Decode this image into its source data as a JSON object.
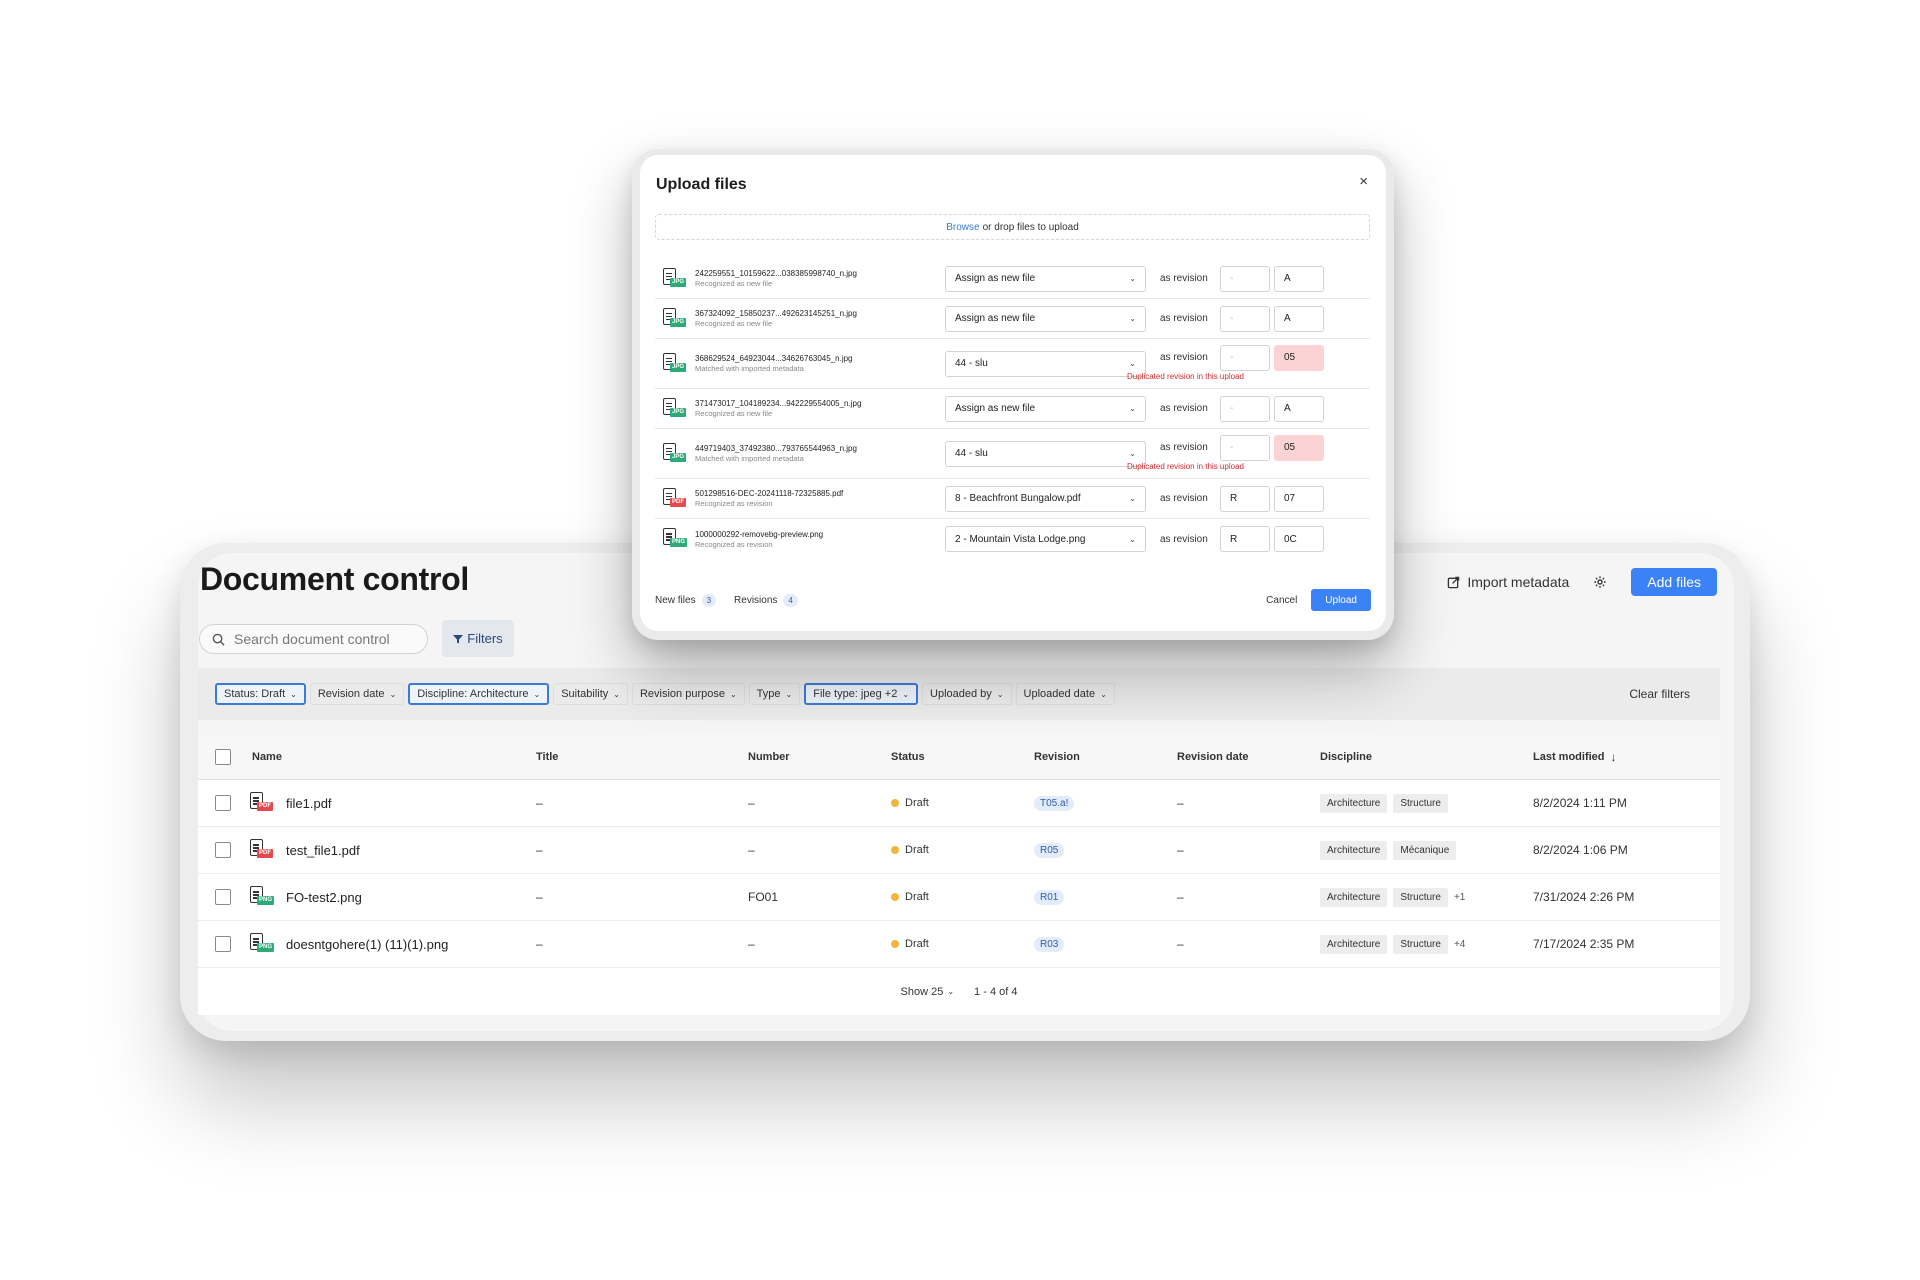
{
  "document_control": {
    "title": "Document control",
    "import_metadata_label": "Import metadata",
    "add_files_label": "Add files",
    "search_placeholder": "Search document control",
    "filters_label": "Filters",
    "filter_chips": [
      {
        "label": "Status: Draft",
        "active": true
      },
      {
        "label": "Revision date",
        "active": false
      },
      {
        "label": "Discipline: Architecture",
        "active": true
      },
      {
        "label": "Suitability",
        "active": false
      },
      {
        "label": "Revision purpose",
        "active": false
      },
      {
        "label": "Type",
        "active": false
      },
      {
        "label": "File type: jpeg +2",
        "active": true
      },
      {
        "label": "Uploaded by",
        "active": false
      },
      {
        "label": "Uploaded date",
        "active": false
      }
    ],
    "clear_filters_label": "Clear filters",
    "columns": {
      "name": "Name",
      "title": "Title",
      "number": "Number",
      "status": "Status",
      "revision": "Revision",
      "revision_date": "Revision date",
      "discipline": "Discipline",
      "last_modified": "Last modified"
    },
    "rows": [
      {
        "name": "file1.pdf",
        "type": "PDF",
        "title": "–",
        "number": "–",
        "status": "Draft",
        "revision": "T05.a!",
        "revision_date": "–",
        "disciplines": [
          "Architecture",
          "Structure"
        ],
        "more": "",
        "last_modified": "8/2/2024 1:11 PM"
      },
      {
        "name": "test_file1.pdf",
        "type": "PDF",
        "title": "–",
        "number": "–",
        "status": "Draft",
        "revision": "R05",
        "revision_date": "–",
        "disciplines": [
          "Architecture",
          "Mécanique"
        ],
        "more": "",
        "last_modified": "8/2/2024 1:06 PM"
      },
      {
        "name": "FO-test2.png",
        "type": "PNG",
        "title": "–",
        "number": "FO01",
        "status": "Draft",
        "revision": "R01",
        "revision_date": "–",
        "disciplines": [
          "Architecture",
          "Structure"
        ],
        "more": "+1",
        "last_modified": "7/31/2024 2:26 PM"
      },
      {
        "name": "doesntgohere(1) (11)(1).png",
        "type": "PNG",
        "title": "–",
        "number": "–",
        "status": "Draft",
        "revision": "R03",
        "revision_date": "–",
        "disciplines": [
          "Architecture",
          "Structure"
        ],
        "more": "+4",
        "last_modified": "7/17/2024 2:35 PM"
      }
    ],
    "pager": {
      "show_label": "Show 25",
      "range_label": "1 - 4 of 4"
    },
    "colors": {
      "accent": "#3b82f6",
      "draft_dot": "#f2b63d",
      "pdf": "#e5484d",
      "png": "#2eaa78"
    }
  },
  "upload_modal": {
    "title": "Upload files",
    "close_label": "×",
    "dropzone": {
      "browse_label": "Browse",
      "rest_label": "or drop files to upload"
    },
    "as_revision_label": "as revision",
    "error_label": "Duplicated revision in this upload",
    "files": [
      {
        "file": "242259551_10159622...038385998740_n.jpg",
        "sub": "Recognized as new file",
        "type": "JPG",
        "assign": "Assign as new file",
        "prefix": "-",
        "rev": "A",
        "error": false
      },
      {
        "file": "367324092_15850237...492623145251_n.jpg",
        "sub": "Recognized as new file",
        "type": "JPG",
        "assign": "Assign as new file",
        "prefix": "-",
        "rev": "A",
        "error": false
      },
      {
        "file": "368629524_64923044...34626763045_n.jpg",
        "sub": "Matched with imported metadata",
        "type": "JPG",
        "assign": "44 - slu",
        "prefix": "-",
        "rev": "05",
        "error": true
      },
      {
        "file": "371473017_104189234...942229554005_n.jpg",
        "sub": "Recognized as new file",
        "type": "JPG",
        "assign": "Assign as new file",
        "prefix": "-",
        "rev": "A",
        "error": false
      },
      {
        "file": "449719403_37492380...793765544963_n.jpg",
        "sub": "Matched with imported metadata",
        "type": "JPG",
        "assign": "44 - slu",
        "prefix": "-",
        "rev": "05",
        "error": true
      },
      {
        "file": "501298516-DEC-20241118-72325885.pdf",
        "sub": "Recognized as revision",
        "type": "PDF",
        "assign": "8 - Beachfront Bungalow.pdf",
        "prefix": "R",
        "rev": "07",
        "error": false
      },
      {
        "file": "1000000292-removebg-preview.png",
        "sub": "Recognized as revision",
        "type": "PNG",
        "assign": "2 - Mountain Vista Lodge.png",
        "prefix": "R",
        "rev": "0C",
        "error": false
      }
    ],
    "new_files_label": "New files",
    "new_files_count": "3",
    "revisions_label": "Revisions",
    "revisions_count": "4",
    "cancel_label": "Cancel",
    "upload_label": "Upload"
  }
}
